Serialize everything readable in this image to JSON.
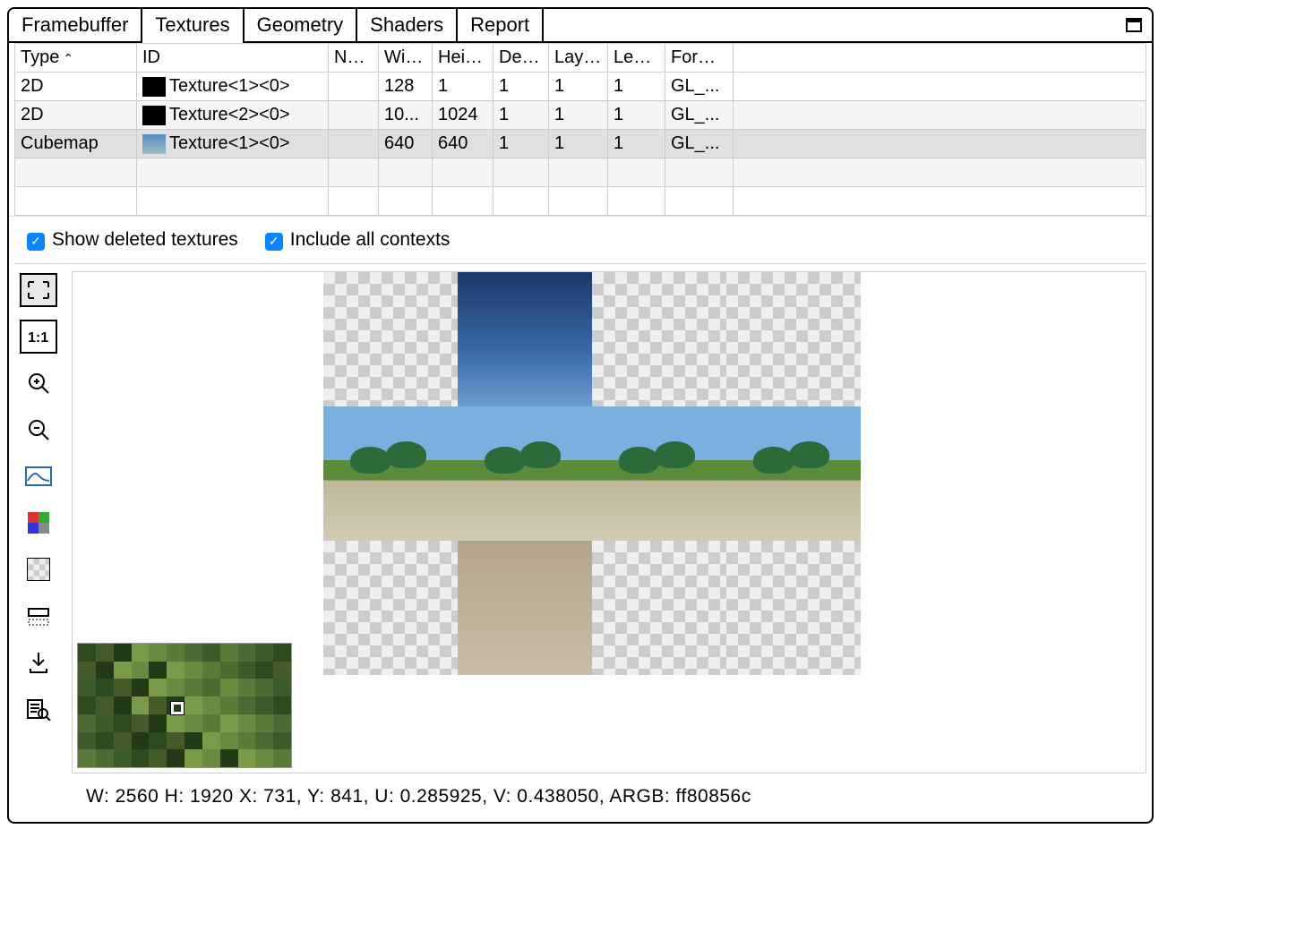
{
  "tabs": [
    "Framebuffer",
    "Textures",
    "Geometry",
    "Shaders",
    "Report"
  ],
  "active_tab": 1,
  "table": {
    "headers": [
      "Type",
      "ID",
      "Name",
      "Width",
      "Height",
      "Depth",
      "Layers",
      "Levels",
      "Format"
    ],
    "sort_col": 0,
    "rows": [
      {
        "type": "2D",
        "id": "Texture<1><0>",
        "name": "",
        "width": "128",
        "height": "1",
        "depth": "1",
        "layers": "1",
        "levels": "1",
        "format": "GL_...",
        "thumb": "black"
      },
      {
        "type": "2D",
        "id": "Texture<2><0>",
        "name": "",
        "width": "10...",
        "height": "1024",
        "depth": "1",
        "layers": "1",
        "levels": "1",
        "format": "GL_...",
        "thumb": "black"
      },
      {
        "type": "Cubemap",
        "id": "Texture<1><0>",
        "name": "",
        "width": "640",
        "height": "640",
        "depth": "1",
        "layers": "1",
        "levels": "1",
        "format": "GL_...",
        "thumb": "sky"
      }
    ],
    "selected": 2
  },
  "options": {
    "show_deleted": {
      "label": "Show deleted textures",
      "checked": true
    },
    "include_all": {
      "label": "Include all contexts",
      "checked": true
    }
  },
  "toolbar": [
    {
      "name": "fit-icon",
      "active": true
    },
    {
      "name": "actual-size-icon"
    },
    {
      "name": "zoom-in-icon"
    },
    {
      "name": "zoom-out-icon"
    },
    {
      "name": "histogram-icon"
    },
    {
      "name": "channels-icon"
    },
    {
      "name": "checker-icon"
    },
    {
      "name": "flip-icon"
    },
    {
      "name": "save-icon"
    },
    {
      "name": "inspect-icon"
    }
  ],
  "status": {
    "text": "W: 2560 H: 1920   X: 731, Y: 841, U: 0.285925, V: 0.438050, ARGB: ff80856c"
  }
}
